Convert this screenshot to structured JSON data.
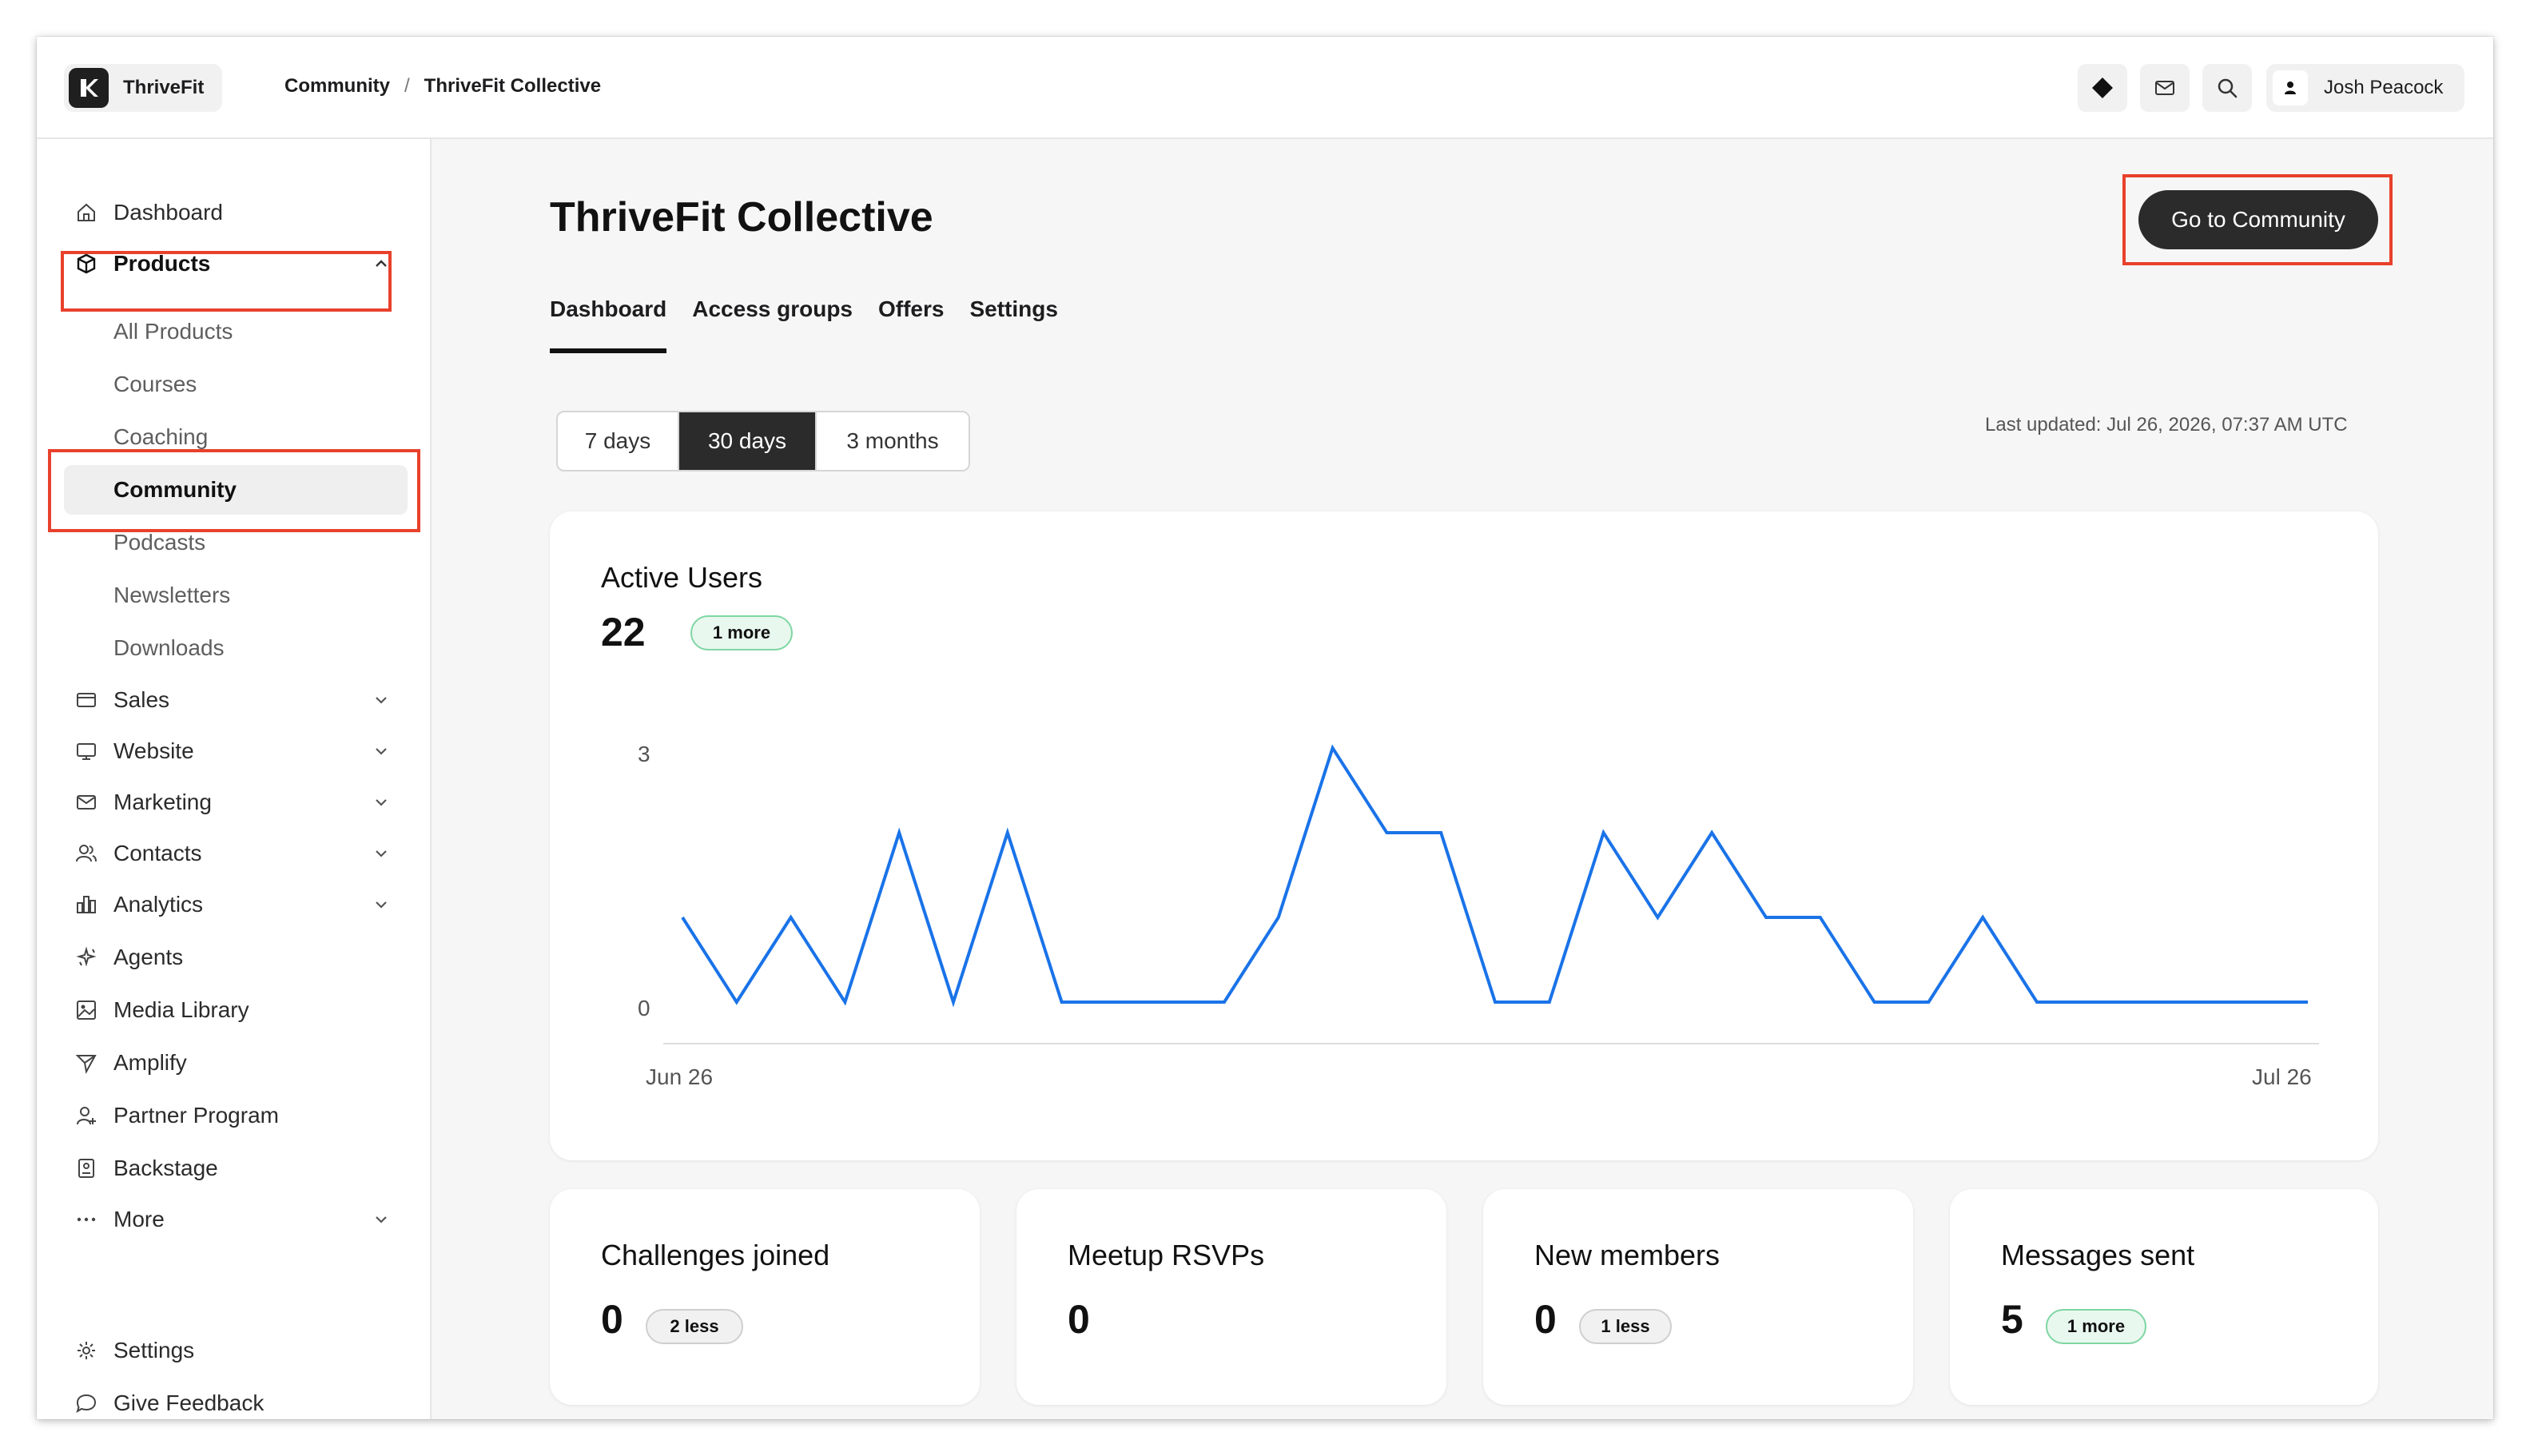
{
  "brand": {
    "name": "ThriveFit"
  },
  "breadcrumb": {
    "parent": "Community",
    "separator": "/",
    "current": "ThriveFit Collective"
  },
  "user": {
    "name": "Josh Peacock"
  },
  "sidebar": {
    "dashboard": "Dashboard",
    "products": "Products",
    "sub": [
      "All Products",
      "Courses",
      "Coaching",
      "Community",
      "Podcasts",
      "Newsletters",
      "Downloads"
    ],
    "sales": "Sales",
    "website": "Website",
    "marketing": "Marketing",
    "contacts": "Contacts",
    "analytics": "Analytics",
    "agents": "Agents",
    "media": "Media Library",
    "amplify": "Amplify",
    "partner": "Partner Program",
    "backstage": "Backstage",
    "more": "More",
    "settings": "Settings",
    "feedback": "Give Feedback"
  },
  "page": {
    "title": "ThriveFit Collective",
    "cta": "Go to Community"
  },
  "tabs": [
    "Dashboard",
    "Access groups",
    "Offers",
    "Settings"
  ],
  "range": {
    "options": [
      "7 days",
      "30 days",
      "3 months"
    ],
    "selected": "30 days"
  },
  "last_updated": "Last updated: Jul 26, 2026, 07:37 AM UTC",
  "active_users": {
    "title": "Active Users",
    "value": "22",
    "delta": "1 more"
  },
  "stats": [
    {
      "title": "Challenges joined",
      "value": "0",
      "delta": "2 less"
    },
    {
      "title": "Meetup RSVPs",
      "value": "0",
      "delta": ""
    },
    {
      "title": "New members",
      "value": "0",
      "delta": "1 less"
    },
    {
      "title": "Messages sent",
      "value": "5",
      "delta": "1 more"
    }
  ],
  "colors": {
    "line": "#1a73e8",
    "highlight": "#e8412c",
    "dark": "#2b2b2b"
  },
  "chart_data": {
    "type": "line",
    "x_start": "Jun 26",
    "x_end": "Jul 26",
    "yticks": [
      "0",
      "3"
    ],
    "ylim": [
      0,
      3
    ],
    "grid": false,
    "series": [
      {
        "values": [
          1,
          0,
          1,
          0,
          2,
          0,
          2,
          0,
          0,
          0,
          0,
          1,
          3,
          2,
          2,
          0,
          0,
          2,
          1,
          2,
          1,
          1,
          0,
          0,
          1,
          0,
          0,
          0,
          0,
          0,
          0
        ]
      }
    ]
  }
}
